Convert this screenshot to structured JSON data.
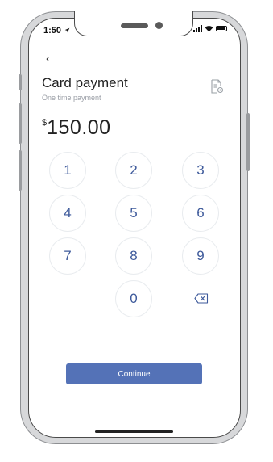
{
  "status_bar": {
    "time": "1:50"
  },
  "header": {
    "back": "‹",
    "title": "Card payment",
    "subtitle": "One time payment"
  },
  "amount": {
    "currency_symbol": "$",
    "value": "150.00"
  },
  "keypad": {
    "keys": [
      "1",
      "2",
      "3",
      "4",
      "5",
      "6",
      "7",
      "8",
      "9",
      "0"
    ],
    "backspace_icon": "backspace-icon"
  },
  "continue_label": "Continue",
  "colors": {
    "accent": "#5472b7",
    "key_text": "#3e5a9b"
  },
  "icons": {
    "receipt": "receipt-settings-icon",
    "location_arrow": "location-arrow-icon"
  }
}
